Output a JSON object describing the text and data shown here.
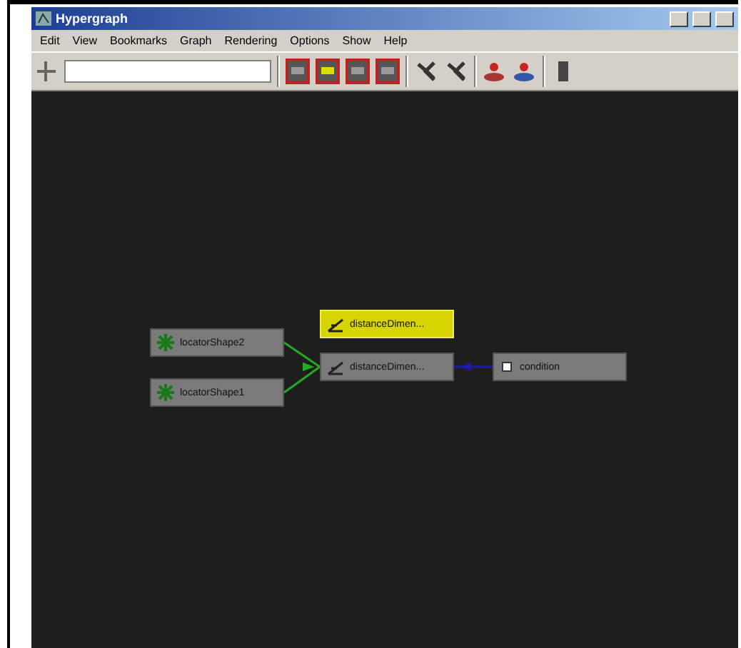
{
  "window": {
    "title": "Hypergraph"
  },
  "menu": [
    "Edit",
    "View",
    "Bookmarks",
    "Graph",
    "Rendering",
    "Options",
    "Show",
    "Help"
  ],
  "nodes": [
    {
      "label": "distanceDimen...",
      "kind": "dimension",
      "selected": true
    },
    {
      "label": "locatorShape2",
      "kind": "locator",
      "selected": false
    },
    {
      "label": "distanceDimen...",
      "kind": "dimension",
      "selected": false
    },
    {
      "label": "condition",
      "kind": "condition",
      "selected": false
    },
    {
      "label": "locatorShape1",
      "kind": "locator",
      "selected": false
    }
  ],
  "edges": [
    {
      "color": "#22aa22"
    },
    {
      "color": "#22aa22"
    },
    {
      "color": "#1a1ab0"
    }
  ]
}
